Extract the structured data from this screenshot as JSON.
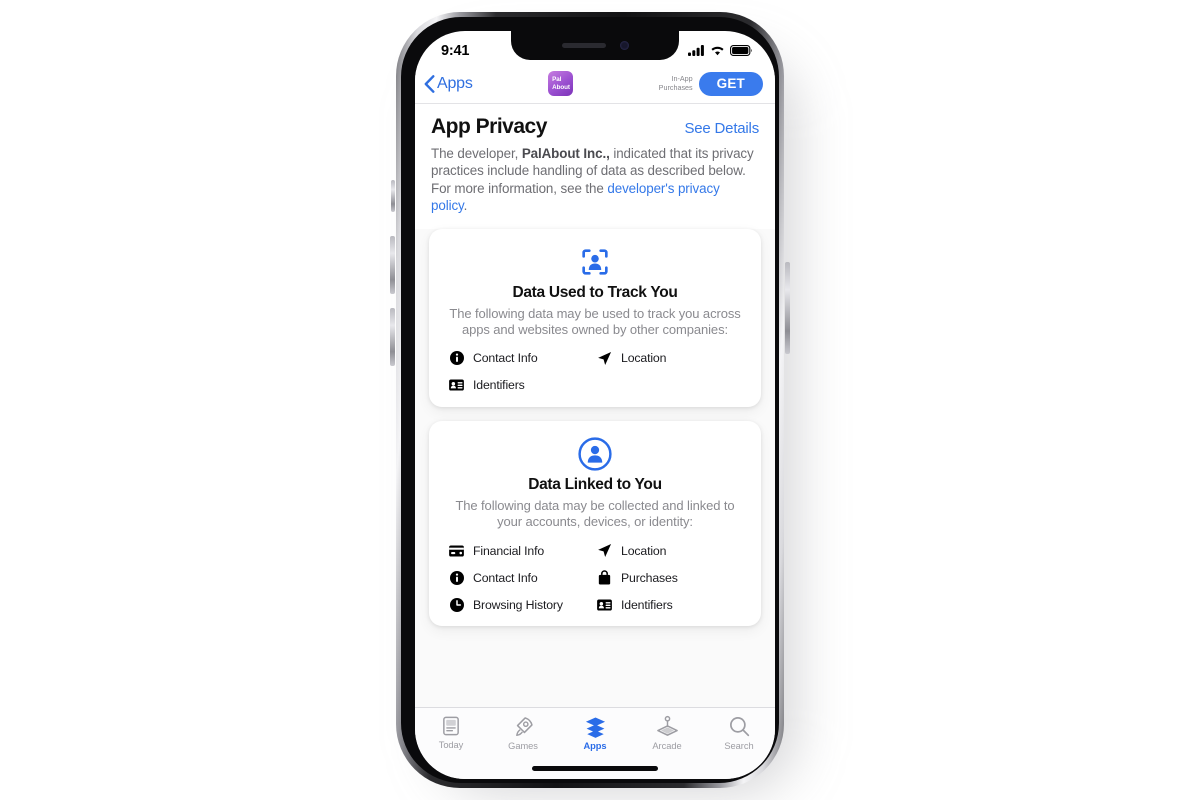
{
  "status_bar": {
    "time": "9:41",
    "icons": [
      "cellular-signal-icon",
      "wifi-icon",
      "battery-icon"
    ]
  },
  "nav_bar": {
    "back_label": "Apps",
    "back_icon": "chevron-left-icon",
    "app_icon": {
      "name": "palabout-app-icon",
      "line1": "Pal",
      "line2": "About"
    },
    "in_app_purchases_line1": "In-App",
    "in_app_purchases_line2": "Purchases",
    "get_label": "GET"
  },
  "section": {
    "title": "App Privacy",
    "see_details_label": "See Details",
    "description_part1": "The developer, ",
    "developer_name": "PalAbout Inc.,",
    "description_part2": " indicated that its privacy practices include handling of data as described below. For more information, see the ",
    "privacy_policy_link": "developer's privacy policy",
    "description_end": "."
  },
  "cards": [
    {
      "icon": "person-in-viewfinder-icon",
      "title": "Data Used to Track You",
      "description": "The following data may be used to track you across apps and websites owned by other companies:",
      "items": [
        {
          "icon": "info-circle-icon",
          "label": "Contact Info"
        },
        {
          "icon": "location-arrow-icon",
          "label": "Location"
        },
        {
          "icon": "id-card-icon",
          "label": "Identifiers"
        }
      ]
    },
    {
      "icon": "person-circle-icon",
      "title": "Data Linked to You",
      "description": "The following data may be collected and linked to your accounts, devices, or identity:",
      "items": [
        {
          "icon": "credit-card-icon",
          "label": "Financial Info"
        },
        {
          "icon": "location-arrow-icon",
          "label": "Location"
        },
        {
          "icon": "info-circle-icon",
          "label": "Contact Info"
        },
        {
          "icon": "shopping-bag-icon",
          "label": "Purchases"
        },
        {
          "icon": "clock-icon",
          "label": "Browsing History"
        },
        {
          "icon": "id-card-icon",
          "label": "Identifiers"
        }
      ]
    }
  ],
  "tab_bar": {
    "tabs": [
      {
        "icon": "today-newspaper-icon",
        "label": "Today",
        "active": false
      },
      {
        "icon": "rocket-icon",
        "label": "Games",
        "active": false
      },
      {
        "icon": "stacked-layers-icon",
        "label": "Apps",
        "active": true
      },
      {
        "icon": "joystick-icon",
        "label": "Arcade",
        "active": false
      },
      {
        "icon": "magnifier-icon",
        "label": "Search",
        "active": false
      }
    ]
  },
  "colors": {
    "accent_blue": "#3478e8",
    "get_button_blue": "#3a7bed",
    "app_icon_purple": "#9a4fd0",
    "secondary_text": "#8a8a8f",
    "page_background": "#fafafa"
  }
}
